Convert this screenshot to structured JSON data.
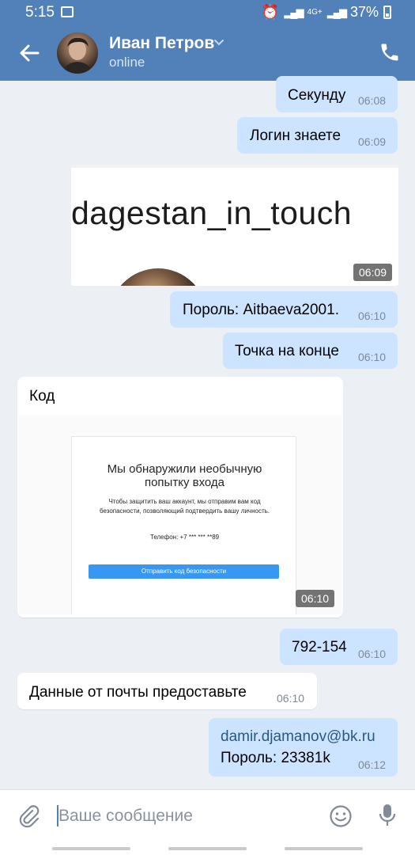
{
  "status_bar": {
    "time": "5:15",
    "network": "4G+",
    "battery": "37%"
  },
  "header": {
    "contact_name": "Иван Петров",
    "contact_status": "online"
  },
  "messages": [
    {
      "text": "Секунду",
      "time": "06:08"
    },
    {
      "text": "Логин знаете",
      "time": "06:09"
    },
    {
      "image_caption": "dagestan_in_touch",
      "time": "06:09"
    },
    {
      "text": "Пороль: Aitbaeva2001.",
      "time": "06:10"
    },
    {
      "text": "Точка на конце",
      "time": "06:10"
    },
    {
      "text": "Код",
      "time": "06:10",
      "screenshot": {
        "title": "Мы обнаружили необычную\nпопытку входа",
        "description": "Чтобы защитить ваш аккаунт, мы отправим вам код\nбезопасности, позволяющий подтвердить вашу личность.",
        "phone": "Телефон: +7 *** *** **89",
        "button": "Отправить код безопасности"
      }
    },
    {
      "text": "792-154",
      "time": "06:10"
    },
    {
      "text": "Данные от почты предоставьте",
      "time": "06:10"
    },
    {
      "email": "damir.djamanov@bk.ru",
      "text": "Пороль: 23381k",
      "time": "06:12"
    }
  ],
  "input": {
    "placeholder": "Ваше сообщение"
  },
  "colors": {
    "header": "#5181b8",
    "outgoing_bubble": "#cce4ff",
    "incoming_bubble": "#ffffff",
    "background": "#ecf0f4",
    "link": "#2a5885"
  }
}
